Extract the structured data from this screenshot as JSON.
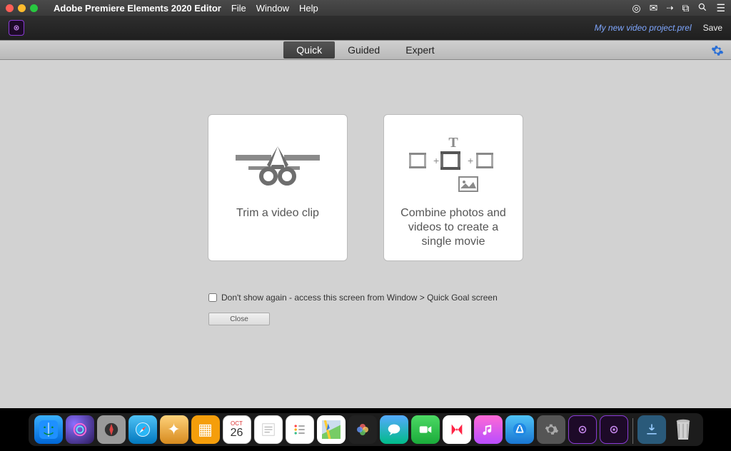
{
  "menubar": {
    "app_name": "Adobe Premiere Elements 2020 Editor",
    "items": [
      "File",
      "Window",
      "Help"
    ]
  },
  "toolbar": {
    "project_name": "My new video project.prel",
    "save_label": "Save"
  },
  "tabs": {
    "quick": "Quick",
    "guided": "Guided",
    "expert": "Expert",
    "active": "quick"
  },
  "cards": {
    "trim": {
      "title": "Trim a video clip"
    },
    "combine": {
      "title": "Combine photos and videos to create a single movie"
    }
  },
  "dont_show": {
    "label": "Don't show again - access this screen from Window > Quick Goal screen",
    "checked": false
  },
  "close_label": "Close",
  "dock": {
    "calendar_month": "OCT",
    "calendar_day": "26"
  }
}
